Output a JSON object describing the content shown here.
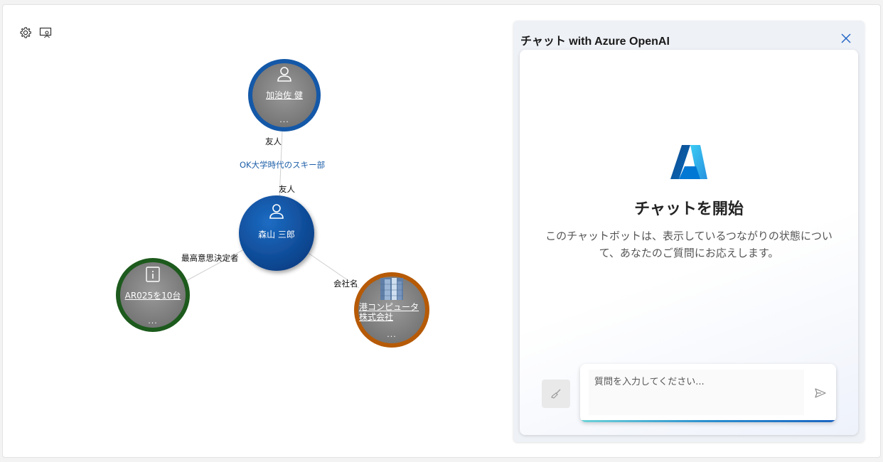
{
  "toolbar": {
    "settings_icon": "gear-icon",
    "presenter_icon": "screen-person-icon"
  },
  "graph": {
    "nodes": [
      {
        "id": "kajisa",
        "name": "加治佐 健",
        "icon": "person-icon",
        "more": "...",
        "ring_color": "#1458a8"
      },
      {
        "id": "moriyama",
        "name": "森山 三郎",
        "icon": "person-icon",
        "fill_color": "#0f56a6"
      },
      {
        "id": "ar025",
        "name": "AR025を10台",
        "icon": "info-book-icon",
        "more": "...",
        "ring_color": "#1d5a1d"
      },
      {
        "id": "minato",
        "name": "港コンピュータ株式会社",
        "icon": "building-photo",
        "more": "...",
        "ring_color": "#b65a07"
      }
    ],
    "edges": {
      "friend_top_label": "友人",
      "friend_note": "OK大学時代のスキー部",
      "friend_bottom_label": "友人",
      "decision_label": "最高意思決定者",
      "company_label": "会社名"
    }
  },
  "chat": {
    "title": "チャット with Azure OpenAI",
    "logo_icon": "azure-logo-icon",
    "start_heading": "チャットを開始",
    "start_description": "このチャットボットは、表示しているつながりの状態について、あなたのご質問にお応えします。",
    "input_placeholder": "質問を入力してください...",
    "clear_icon": "broom-icon",
    "send_icon": "send-icon",
    "close_icon": "close-icon"
  }
}
